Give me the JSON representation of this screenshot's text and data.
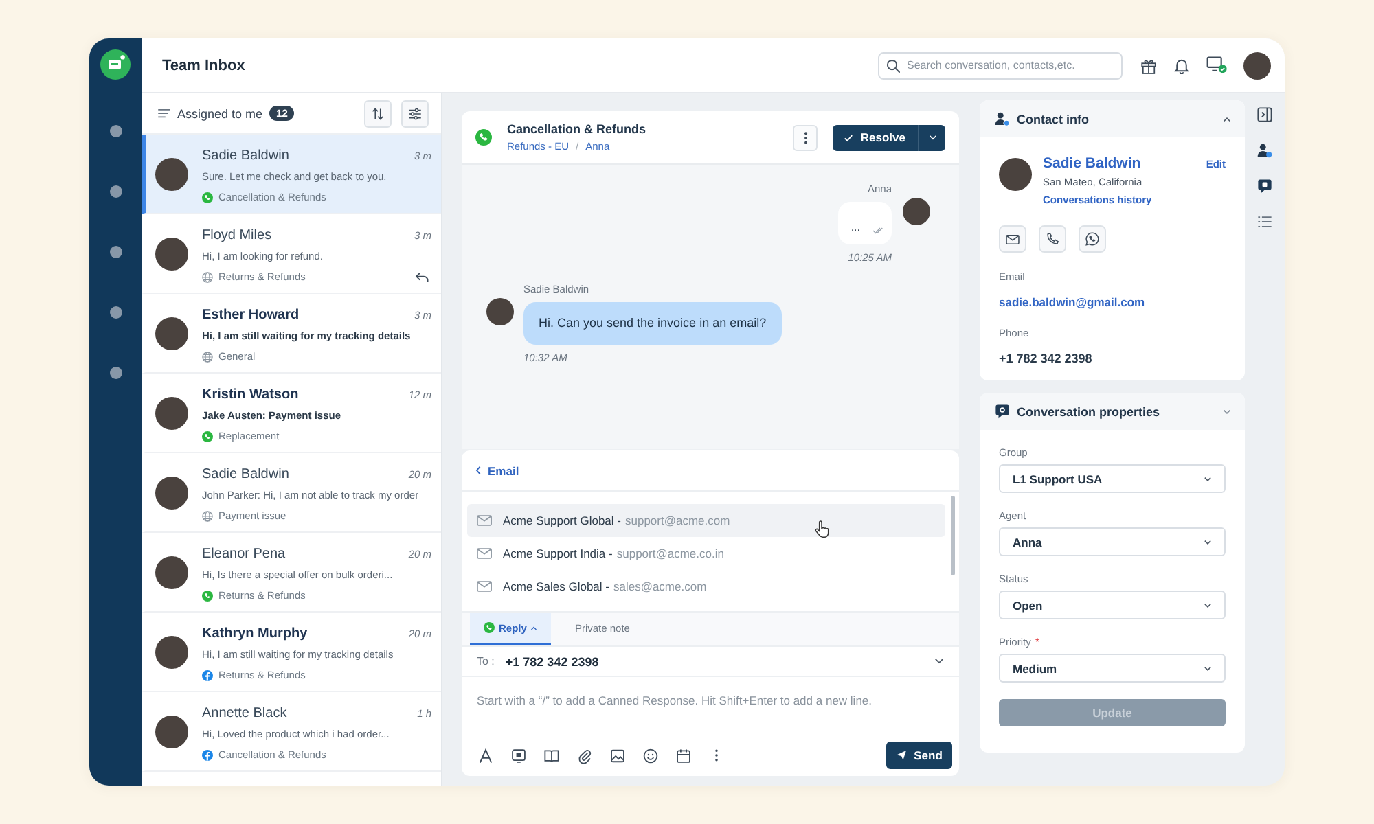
{
  "app": {
    "title": "Team Inbox",
    "search": {
      "placeholder": "Search conversation, contacts,etc."
    }
  },
  "inbox": {
    "filter": "Assigned to me",
    "count": "12",
    "conversations": [
      {
        "name": "Sadie Baldwin",
        "time": "3 m",
        "preview": "Sure. Let me check and get back to you.",
        "tag": "Cancellation & Refunds",
        "kind": "whatsapp",
        "selected": true,
        "unread": false,
        "preview_unread": false,
        "replied": false
      },
      {
        "name": "Floyd Miles",
        "time": "3 m",
        "preview": "Hi, I am looking for refund.",
        "tag": "Returns & Refunds",
        "kind": "web",
        "selected": false,
        "unread": false,
        "preview_unread": false,
        "replied": true
      },
      {
        "name": "Esther Howard",
        "time": "3 m",
        "preview": "Hi, I am still waiting for my tracking details",
        "tag": "General",
        "kind": "web",
        "selected": false,
        "unread": true,
        "preview_unread": true,
        "replied": false
      },
      {
        "name": "Kristin Watson",
        "time": "12 m",
        "preview": "Jake Austen: Payment issue",
        "tag": "Replacement",
        "kind": "whatsapp",
        "selected": false,
        "unread": true,
        "preview_unread": true,
        "replied": false
      },
      {
        "name": "Sadie Baldwin",
        "time": "20 m",
        "preview": "John Parker: Hi, I am not able to track my order",
        "tag": "Payment issue",
        "kind": "web",
        "selected": false,
        "unread": false,
        "preview_unread": false,
        "replied": false
      },
      {
        "name": "Eleanor Pena",
        "time": "20 m",
        "preview": "Hi, Is there a special offer on bulk orderi...",
        "tag": "Returns & Refunds",
        "kind": "whatsapp",
        "selected": false,
        "unread": false,
        "preview_unread": false,
        "replied": false
      },
      {
        "name": "Kathryn Murphy",
        "time": "20 m",
        "preview": "Hi, I am still waiting for my tracking details",
        "tag": "Returns & Refunds",
        "kind": "facebook",
        "selected": false,
        "unread": true,
        "preview_unread": false,
        "replied": false
      },
      {
        "name": "Annette Black",
        "time": "1 h",
        "preview": "Hi, Loved the product which i had order...",
        "tag": "Cancellation & Refunds",
        "kind": "facebook",
        "selected": false,
        "unread": false,
        "preview_unread": false,
        "replied": false
      }
    ]
  },
  "conversation": {
    "title": "Cancellation & Refunds",
    "kind": "whatsapp",
    "breadcrumb": [
      "Refunds - EU",
      "Anna"
    ],
    "separator": "/",
    "resolve": "Resolve",
    "messages": [
      {
        "kind": "outgoing",
        "sender": "Anna",
        "text": "...",
        "time": "10:25 AM",
        "read": true
      },
      {
        "kind": "incoming",
        "sender": "Sadie Baldwin",
        "text": "Hi. Can you send the invoice in an email?",
        "time": "10:32 AM",
        "read": false
      }
    ]
  },
  "composer": {
    "back": "Email",
    "mailboxes": [
      {
        "name": "Acme Support Global -",
        "address": "support@acme.com",
        "hovered": true
      },
      {
        "name": "Acme Support India -",
        "address": "support@acme.co.in",
        "hovered": false
      },
      {
        "name": "Acme Sales Global -",
        "address": "sales@acme.com",
        "hovered": false
      }
    ],
    "tabs": [
      {
        "label": "Reply",
        "kind": "whatsapp",
        "dropdown": true,
        "selected": true
      },
      {
        "label": "Private note",
        "kind": "note",
        "dropdown": false,
        "selected": false
      }
    ],
    "to_label": "To :",
    "to": "+1 782 342 2398",
    "placeholder": "Start with a “/” to add a Canned Response. Hit Shift+Enter to add a new line.",
    "send": "Send"
  },
  "contact": {
    "title": "Contact info",
    "name": "Sadie Baldwin",
    "location": "San Mateo, California",
    "history": "Conversations history",
    "edit": "Edit",
    "email_label": "Email",
    "email": "sadie.baldwin@gmail.com",
    "phone_label": "Phone",
    "phone": "+1 782 342 2398"
  },
  "properties": {
    "title": "Conversation properties",
    "fields": [
      {
        "label": "Group",
        "value": "L1 Support USA"
      },
      {
        "label": "Agent",
        "value": "Anna"
      },
      {
        "label": "Status",
        "value": "Open"
      },
      {
        "label": "Priority",
        "required_mark": "*",
        "value": "Medium"
      }
    ],
    "update": {
      "label": "Update",
      "disabled": true
    }
  }
}
